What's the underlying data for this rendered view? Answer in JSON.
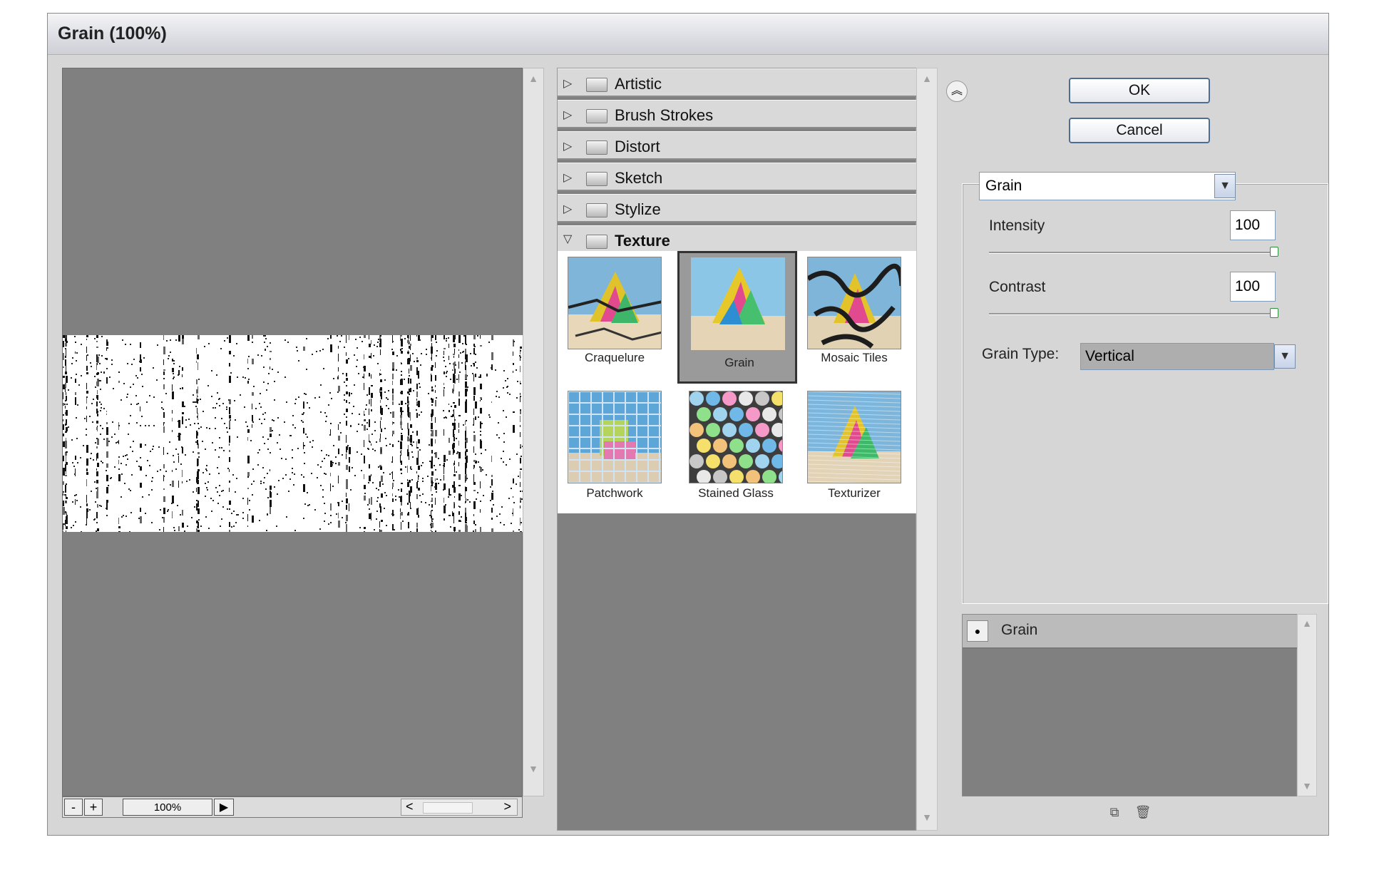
{
  "dialog": {
    "title": "Grain (100%)"
  },
  "preview": {
    "zoom_out": "-",
    "zoom_in": "+",
    "zoom_value": "100%",
    "zoom_menu": "▶",
    "scroll_left": "<",
    "scroll_right": ">"
  },
  "filter_list": {
    "folders": [
      {
        "label": "Artistic",
        "expanded": false
      },
      {
        "label": "Brush Strokes",
        "expanded": false
      },
      {
        "label": "Distort",
        "expanded": false
      },
      {
        "label": "Sketch",
        "expanded": false
      },
      {
        "label": "Stylize",
        "expanded": false
      },
      {
        "label": "Texture",
        "expanded": true
      }
    ],
    "texture_filters": [
      {
        "label": "Craquelure"
      },
      {
        "label": "Grain",
        "selected": true
      },
      {
        "label": "Mosaic Tiles"
      },
      {
        "label": "Patchwork"
      },
      {
        "label": "Stained Glass"
      },
      {
        "label": "Texturizer"
      }
    ]
  },
  "buttons": {
    "ok": "OK",
    "cancel": "Cancel"
  },
  "settings": {
    "filter_select": "Grain",
    "intensity_label": "Intensity",
    "intensity_value": "100",
    "contrast_label": "Contrast",
    "contrast_value": "100",
    "grain_type_label": "Grain Type:",
    "grain_type_value": "Vertical"
  },
  "layers": {
    "items": [
      {
        "label": "Grain"
      }
    ]
  },
  "colors": {
    "dialog_bg": "#d6d6d6",
    "canvas_gray": "#808080",
    "button_border": "#4f6d93"
  }
}
